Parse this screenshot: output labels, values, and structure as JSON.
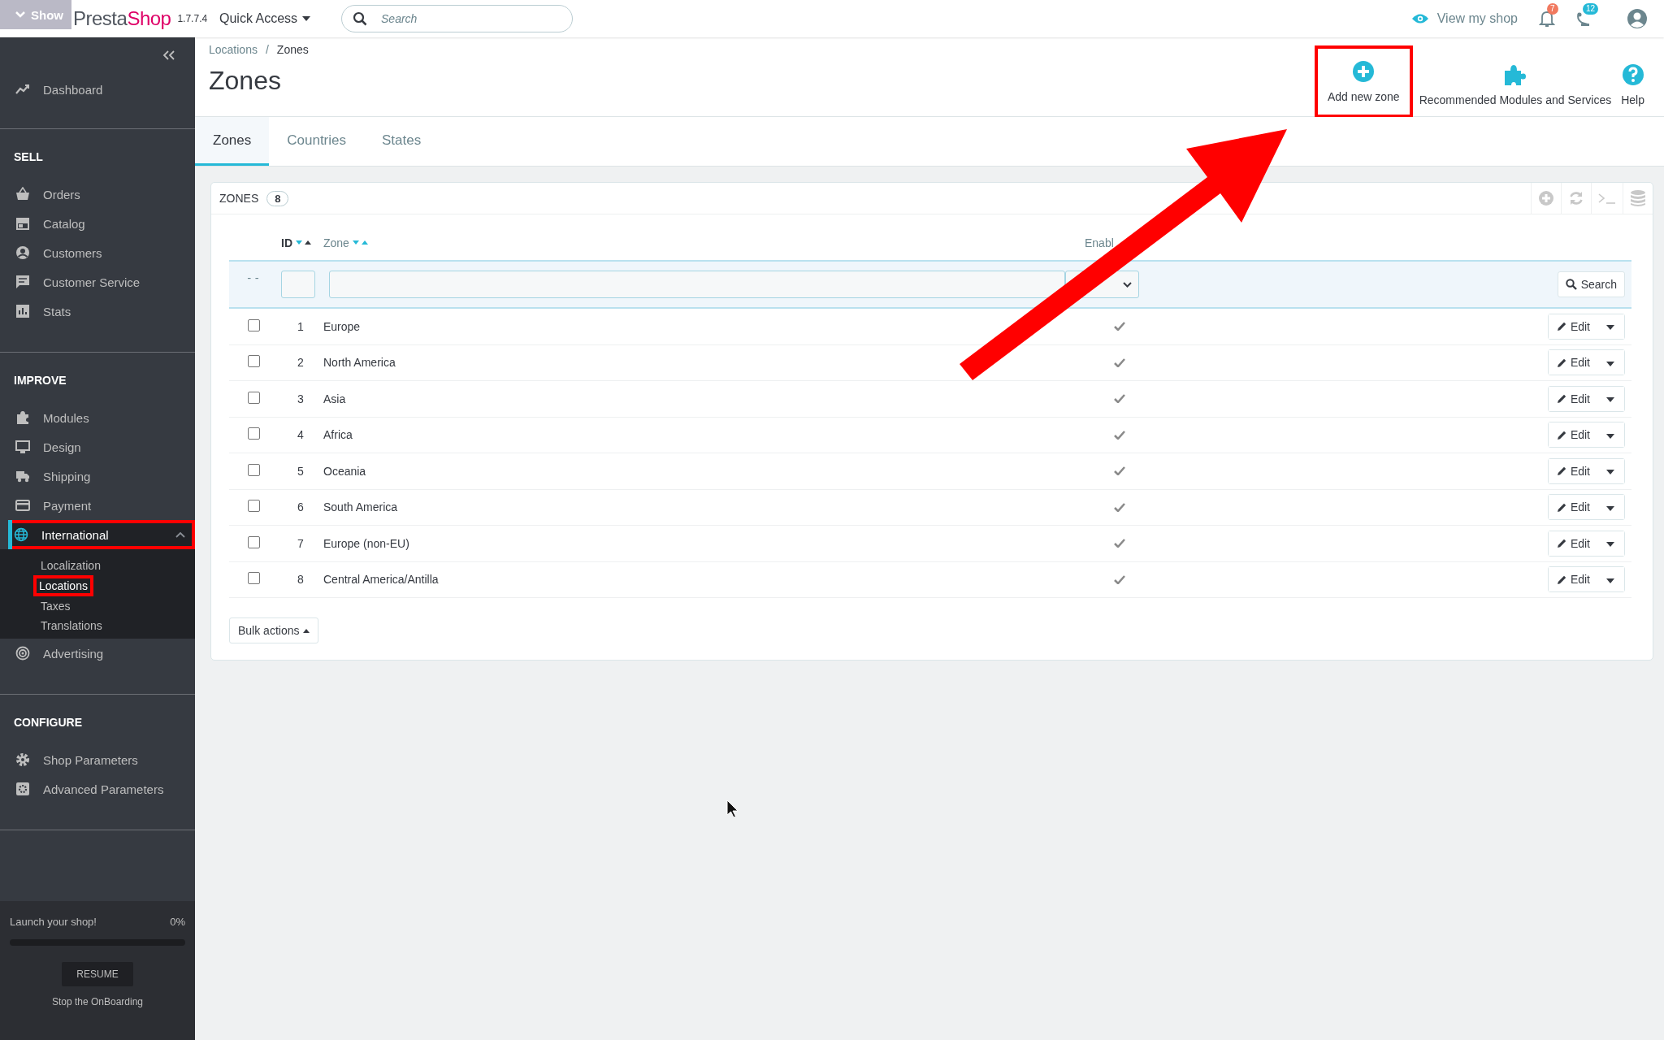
{
  "overlay_label": "Show",
  "logo": {
    "part_1": "Presta",
    "part_2": "Shop",
    "version": "1.7.7.4"
  },
  "quick_access": "Quick Access",
  "search": {
    "placeholder": "Search"
  },
  "header_right": {
    "view_shop": "View my shop",
    "notifications": [
      {
        "count": "7",
        "color": "#f1795f"
      },
      {
        "count": "12",
        "color": "#25b9d7"
      }
    ]
  },
  "sidebar": {
    "sections": [
      {
        "items": [
          {
            "label": "Dashboard",
            "selected": false,
            "highlighted": false
          }
        ]
      },
      {
        "title": "SELL",
        "items": [
          {
            "label": "Orders",
            "selected": false,
            "highlighted": false
          },
          {
            "label": "Catalog",
            "selected": false,
            "highlighted": false
          },
          {
            "label": "Customers",
            "selected": false,
            "highlighted": false
          },
          {
            "label": "Customer Service",
            "selected": false,
            "highlighted": false
          },
          {
            "label": "Stats",
            "selected": false,
            "highlighted": false
          }
        ]
      },
      {
        "title": "IMPROVE",
        "items": [
          {
            "label": "Modules",
            "selected": false,
            "highlighted": false
          },
          {
            "label": "Design",
            "selected": false,
            "highlighted": false
          },
          {
            "label": "Shipping",
            "selected": false,
            "highlighted": false
          },
          {
            "label": "Payment",
            "selected": false,
            "highlighted": false
          },
          {
            "label": "International",
            "selected": true,
            "expanded": true,
            "highlighted": true,
            "children": [
              {
                "label": "Localization",
                "selected": false,
                "highlighted": false
              },
              {
                "label": "Locations",
                "selected": true,
                "highlighted": true
              },
              {
                "label": "Taxes",
                "selected": false,
                "highlighted": false
              },
              {
                "label": "Translations",
                "selected": false,
                "highlighted": false
              }
            ]
          },
          {
            "label": "Advertising",
            "selected": false,
            "highlighted": false
          }
        ]
      },
      {
        "title": "CONFIGURE",
        "items": [
          {
            "label": "Shop Parameters",
            "selected": false,
            "highlighted": false
          },
          {
            "label": "Advanced Parameters",
            "selected": false,
            "highlighted": false
          }
        ]
      }
    ],
    "onboarding": {
      "title": "Launch your shop!",
      "percent": "0%",
      "level": 0,
      "button": "RESUME",
      "stop": "Stop the OnBoarding"
    }
  },
  "breadcrumb": [
    "Locations",
    "Zones"
  ],
  "breadcrumb_separator": "/",
  "page_title": "Zones",
  "toolbar": [
    {
      "label": "Add new zone",
      "highlighted": true
    },
    {
      "label": "Recommended Modules and Services",
      "highlighted": false
    },
    {
      "label": "Help",
      "highlighted": false
    }
  ],
  "tabs": [
    {
      "label": "Zones",
      "selected": true
    },
    {
      "label": "Countries",
      "selected": false
    },
    {
      "label": "States",
      "selected": false
    }
  ],
  "panel": {
    "title": "ZONES",
    "count": "8",
    "columns": [
      {
        "label": "ID",
        "sorted": true
      },
      {
        "label": "Zone",
        "sorted": false
      },
      {
        "label": "Enabl"
      }
    ],
    "filter": {
      "checkbox_column_mark": "--",
      "search_button": "Search"
    },
    "rows": [
      {
        "checked": false,
        "id": "1",
        "zone": "Europe",
        "enabled": true,
        "action": "Edit"
      },
      {
        "checked": false,
        "id": "2",
        "zone": "North America",
        "enabled": true,
        "action": "Edit"
      },
      {
        "checked": false,
        "id": "3",
        "zone": "Asia",
        "enabled": true,
        "action": "Edit"
      },
      {
        "checked": false,
        "id": "4",
        "zone": "Africa",
        "enabled": true,
        "action": "Edit"
      },
      {
        "checked": false,
        "id": "5",
        "zone": "Oceania",
        "enabled": true,
        "action": "Edit"
      },
      {
        "checked": false,
        "id": "6",
        "zone": "South America",
        "enabled": true,
        "action": "Edit"
      },
      {
        "checked": false,
        "id": "7",
        "zone": "Europe (non-EU)",
        "enabled": true,
        "action": "Edit"
      },
      {
        "checked": false,
        "id": "8",
        "zone": "Central America/Antilla",
        "enabled": true,
        "action": "Edit"
      }
    ],
    "bulk_actions": "Bulk actions"
  }
}
